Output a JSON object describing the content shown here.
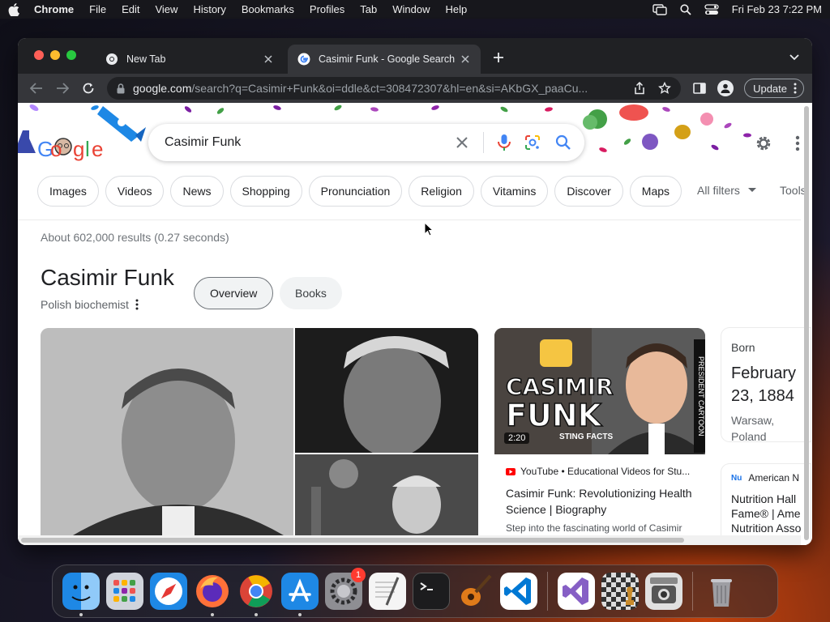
{
  "menubar": {
    "app_name": "Chrome",
    "items": [
      "File",
      "Edit",
      "View",
      "History",
      "Bookmarks",
      "Profiles",
      "Tab",
      "Window",
      "Help"
    ],
    "datetime": "Fri Feb 23  7:22 PM"
  },
  "browser": {
    "tabs": [
      {
        "title": "New Tab",
        "active": false
      },
      {
        "title": "Casimir Funk - Google Search",
        "active": true
      }
    ],
    "address": {
      "host": "google.com",
      "path": "/search?q=Casimir+Funk&oi=ddle&ct=308472307&hl=en&si=AKbGX_paaCu..."
    },
    "update_label": "Update"
  },
  "search": {
    "query": "Casimir Funk",
    "chips": [
      "Images",
      "Videos",
      "News",
      "Shopping",
      "Pronunciation",
      "Religion",
      "Vitamins",
      "Discover",
      "Maps"
    ],
    "all_filters": "All filters",
    "tools": "Tools",
    "result_stats": "About 602,000 results (0.27 seconds)"
  },
  "entity": {
    "title": "Casimir Funk",
    "subtitle": "Polish biochemist",
    "tabs": [
      "Overview",
      "Books"
    ]
  },
  "video": {
    "thumb_line1": "CASIMIR",
    "thumb_line2": "FUNK",
    "thumb_sub": "STING FACTS",
    "thumb_side": "PRESIDENT CARTOON",
    "duration": "2:20",
    "source": "YouTube • Educational Videos for Stu...",
    "title": "Casimir Funk: Revolutionizing Health Science | Biography",
    "snippet": "Step into the fascinating world of Casimir"
  },
  "born": {
    "label": "Born",
    "date": "February 23, 1884",
    "place": "Warsaw, Poland"
  },
  "side_card": {
    "source_abbr": "Nu",
    "source": "American N",
    "title_lines": [
      "Nutrition Hall",
      "Fame® | Ame",
      "Nutrition Asso"
    ]
  },
  "dock": {
    "apps": [
      "finder",
      "launchpad",
      "safari",
      "firefox",
      "chrome",
      "app-store",
      "system-settings",
      "textedit",
      "terminal",
      "garageband",
      "vscode",
      "visual-studio",
      "chess",
      "screenshot",
      "trash"
    ],
    "system_settings_badge": "1"
  },
  "colors": {
    "google_blue": "#4285f4",
    "google_red": "#ea4335",
    "google_yellow": "#fbbc05",
    "google_green": "#34a853",
    "chrome_dark": "#202124"
  }
}
